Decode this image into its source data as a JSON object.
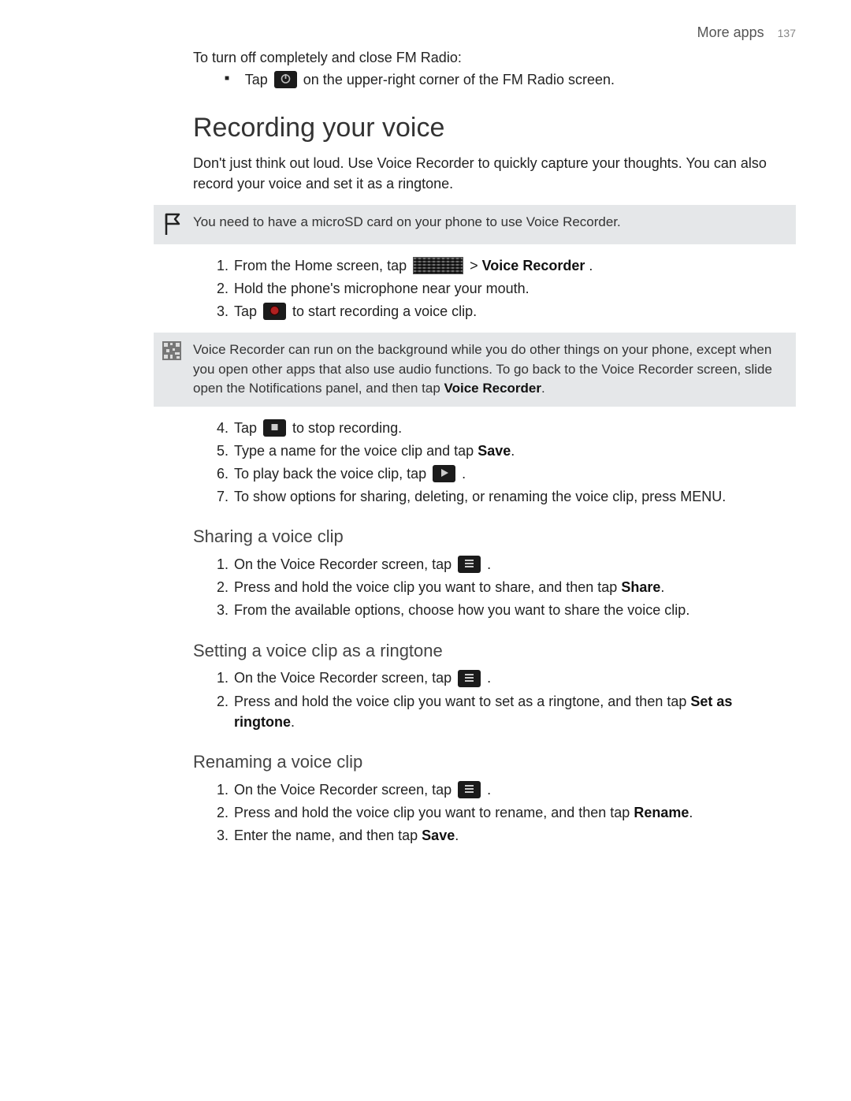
{
  "header": {
    "section": "More apps",
    "page_no": "137"
  },
  "fm": {
    "intro": "To turn off completely and close FM Radio:",
    "bullet_pre": "Tap ",
    "bullet_post": " on the upper-right corner of the FM Radio screen."
  },
  "h1": "Recording your voice",
  "intro": "Don't just think out loud. Use Voice Recorder to quickly capture your thoughts. You can also record your voice and set it as a ringtone.",
  "note1": "You need to have a microSD card on your phone to use Voice Recorder.",
  "steps1": {
    "s1_pre": "From the Home screen, tap ",
    "s1_mid": " > ",
    "s1_app": "Voice Recorder",
    "s1_end": ".",
    "s2": "Hold the phone's microphone near your mouth.",
    "s3_pre": "Tap ",
    "s3_post": " to start recording a voice clip."
  },
  "note2_a": "Voice Recorder can run on the background while you do other things on your phone, except when you open other apps that also use audio functions. To go back to the Voice Recorder screen, slide open the Notifications panel, and then tap ",
  "note2_b": "Voice Recorder",
  "note2_c": ".",
  "steps2": {
    "s4_pre": "Tap ",
    "s4_post": " to stop recording.",
    "s5_pre": "Type a name for the voice clip and tap ",
    "s5_bold": "Save",
    "s5_end": ".",
    "s6_pre": "To play back the voice clip, tap ",
    "s6_end": ".",
    "s7": "To show options for sharing, deleting, or renaming the voice clip, press MENU."
  },
  "share": {
    "h": "Sharing a voice clip",
    "s1_pre": "On the Voice Recorder screen, tap ",
    "s1_end": ".",
    "s2_pre": "Press and hold the voice clip you want to share, and then tap ",
    "s2_bold": "Share",
    "s2_end": ".",
    "s3": "From the available options, choose how you want to share the voice clip."
  },
  "ring": {
    "h": "Setting a voice clip as a ringtone",
    "s1_pre": "On the Voice Recorder screen, tap ",
    "s1_end": ".",
    "s2_pre": "Press and hold the voice clip you want to set as a ringtone, and then tap ",
    "s2_bold": "Set as ringtone",
    "s2_end": "."
  },
  "rename": {
    "h": "Renaming a voice clip",
    "s1_pre": "On the Voice Recorder screen, tap ",
    "s1_end": ".",
    "s2_pre": "Press and hold the voice clip you want to rename, and then tap ",
    "s2_bold": "Rename",
    "s2_end": ".",
    "s3_pre": "Enter the name, and then tap ",
    "s3_bold": "Save",
    "s3_end": "."
  }
}
